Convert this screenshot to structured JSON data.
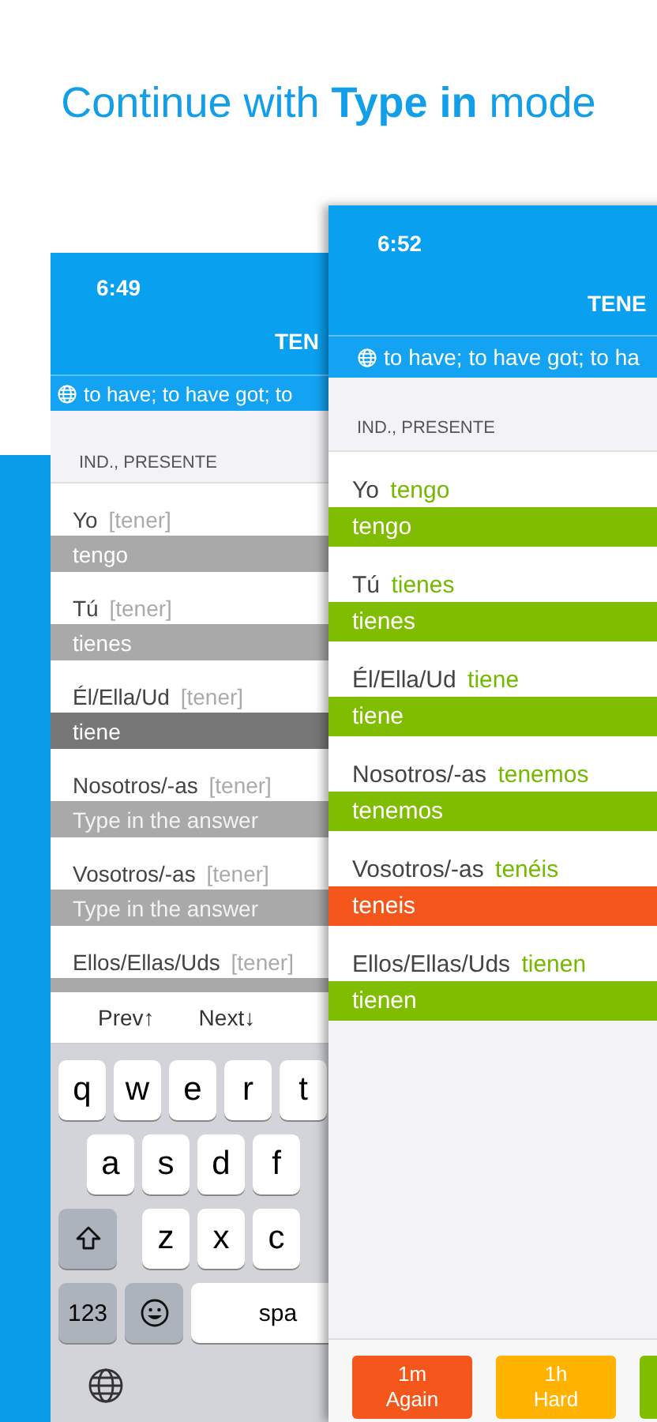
{
  "headline": "Continue with **Type in** mode",
  "back_screen": {
    "time": "6:49",
    "title": "TEN",
    "translation": "to have; to have got; to",
    "section": "IND., PRESENTE",
    "rows": [
      {
        "pronoun": "Yo",
        "hint": "[tener]",
        "answer": "tengo",
        "selected": false
      },
      {
        "pronoun": "Tú",
        "hint": "[tener]",
        "answer": "tienes",
        "selected": false
      },
      {
        "pronoun": "Él/Ella/Ud",
        "hint": "[tener]",
        "answer": "tiene",
        "selected": true
      },
      {
        "pronoun": "Nosotros/-as",
        "hint": "[tener]",
        "placeholder": "Type in the answer",
        "selected": false
      },
      {
        "pronoun": "Vosotros/-as",
        "hint": "[tener]",
        "placeholder": "Type in the answer",
        "selected": false
      },
      {
        "pronoun": "Ellos/Ellas/Uds",
        "hint": "[tener]",
        "selected": false
      }
    ],
    "toolbar": [
      "Prev↑",
      "Next↓"
    ],
    "keyboard": [
      [
        {
          "kind": "letter",
          "label": "q"
        },
        {
          "kind": "letter",
          "label": "w"
        },
        {
          "kind": "letter",
          "label": "e"
        },
        {
          "kind": "letter",
          "label": "r"
        },
        {
          "kind": "letter",
          "label": "t"
        }
      ],
      [
        {
          "kind": "letter",
          "label": "a"
        },
        {
          "kind": "letter",
          "label": "s"
        },
        {
          "kind": "letter",
          "label": "d"
        },
        {
          "kind": "letter",
          "label": "f"
        }
      ],
      [
        {
          "kind": "shift"
        },
        {
          "kind": "letter",
          "label": "z"
        },
        {
          "kind": "letter",
          "label": "x"
        },
        {
          "kind": "letter",
          "label": "c"
        }
      ],
      [
        {
          "kind": "mode",
          "label": "123"
        },
        {
          "kind": "emoji"
        },
        {
          "kind": "space",
          "label": "spa"
        }
      ],
      [
        {
          "kind": "globe"
        }
      ]
    ]
  },
  "front_screen": {
    "time": "6:52",
    "title": "TENE",
    "translation": "to have; to have got; to ha",
    "section": "IND., PRESENTE",
    "rows": [
      {
        "pronoun": "Yo",
        "solution": "tengo",
        "answer": "tengo",
        "correct": true
      },
      {
        "pronoun": "Tú",
        "solution": "tienes",
        "answer": "tienes",
        "correct": true
      },
      {
        "pronoun": "Él/Ella/Ud",
        "solution": "tiene",
        "answer": "tiene",
        "correct": true
      },
      {
        "pronoun": "Nosotros/-as",
        "solution": "tenemos",
        "answer": "tenemos",
        "correct": true
      },
      {
        "pronoun": "Vosotros/-as",
        "solution": "tenéis",
        "answer": "teneis",
        "correct": false
      },
      {
        "pronoun": "Ellos/Ellas/Uds",
        "solution": "tienen",
        "answer": "tienen",
        "correct": true
      }
    ],
    "grade_buttons": [
      {
        "interval": "1m",
        "label": "Again",
        "color": "#f5561b"
      },
      {
        "interval": "1h",
        "label": "Hard",
        "color": "#ffb300"
      },
      {
        "color": "#80bc00"
      }
    ]
  }
}
